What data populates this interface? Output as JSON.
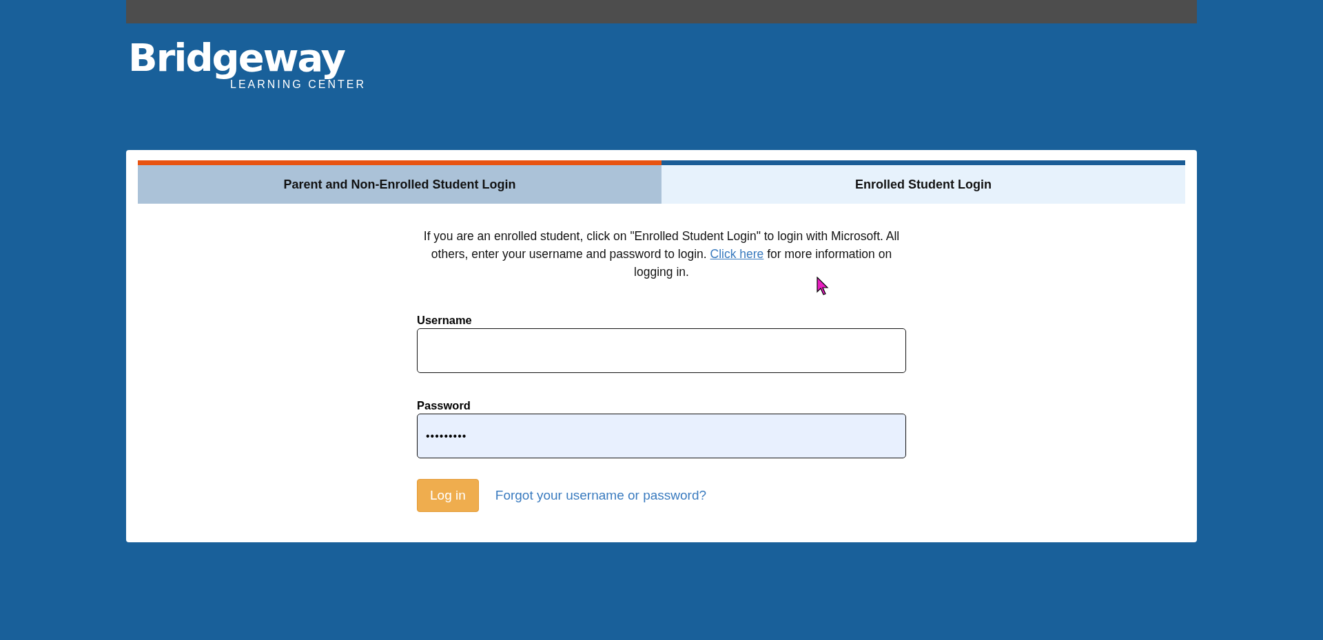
{
  "logo": {
    "name": "Bridgeway",
    "tagline": "LEARNING CENTER"
  },
  "tabs": [
    {
      "label": "Parent and Non-Enrolled Student Login",
      "selected": true
    },
    {
      "label": "Enrolled Student Login",
      "selected": false
    }
  ],
  "intro": {
    "before": "If you are an enrolled student, click on \"Enrolled Student Login\" to login with Microsoft. All others, enter your username and password to login.",
    "link": "Click here",
    "after": "for more information on logging in."
  },
  "fields": [
    {
      "label": "Username",
      "autofilled": false
    },
    {
      "label": "Password",
      "value": "•••••••••",
      "autofilled": true
    }
  ],
  "login_button": "Log in",
  "forgot_link": "Forgot your username or password?"
}
